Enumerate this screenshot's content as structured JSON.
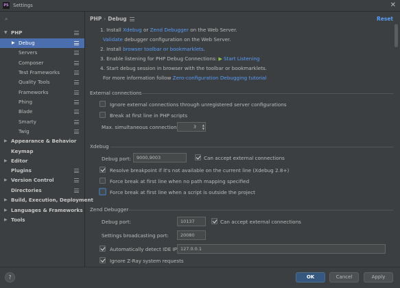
{
  "window": {
    "title": "Settings",
    "app_icon_text": "PS",
    "close_glyph": "✕"
  },
  "search": {
    "value": "",
    "placeholder": ""
  },
  "sidebar": {
    "items": [
      {
        "label": "PHP"
      },
      {
        "label": "Debug"
      },
      {
        "label": "Servers"
      },
      {
        "label": "Composer"
      },
      {
        "label": "Test Frameworks"
      },
      {
        "label": "Quality Tools"
      },
      {
        "label": "Frameworks"
      },
      {
        "label": "Phing"
      },
      {
        "label": "Blade"
      },
      {
        "label": "Smarty"
      },
      {
        "label": "Twig"
      },
      {
        "label": "Appearance & Behavior"
      },
      {
        "label": "Keymap"
      },
      {
        "label": "Editor"
      },
      {
        "label": "Plugins"
      },
      {
        "label": "Version Control"
      },
      {
        "label": "Directories"
      },
      {
        "label": "Build, Execution, Deployment"
      },
      {
        "label": "Languages & Frameworks"
      },
      {
        "label": "Tools"
      }
    ]
  },
  "header": {
    "crumb_parent": "PHP",
    "crumb_sep": "›",
    "crumb_current": "Debug",
    "reset": "Reset"
  },
  "steps": {
    "s1_a": "1. Install ",
    "s1_xdebug": "Xdebug",
    "s1_or": " or ",
    "s1_zend": "Zend Debugger",
    "s1_b": " on the Web Server.",
    "s1_validate": "Validate",
    "s1_validate_rest": " debugger configuration on the Web Server.",
    "s2_a": "2. Install ",
    "s2_link": "browser toolbar or bookmarklets",
    "s2_b": ".",
    "s3_a": "3. Enable listening for PHP Debug Connections: ",
    "s3_link": "Start Listening",
    "s4": "4. Start debug session in browser with the toolbar or bookmarklets.",
    "s4_more": "For more information follow ",
    "s4_link": "Zero-configuration Debugging tutorial"
  },
  "external": {
    "title": "External connections",
    "ignore_unregistered": "Ignore external connections through unregistered server configurations",
    "break_first_line": "Break at first line in PHP scripts",
    "max_label": "Max. simultaneous connections:",
    "max_value": "3"
  },
  "xdebug": {
    "title": "Xdebug",
    "port_label": "Debug port:",
    "port_value": "9000,9003",
    "accept_external": "Can accept external connections",
    "resolve_bp": "Resolve breakpoint if it's not available on the current line (Xdebug 2.8+)",
    "force_break_mapping": "Force break at first line when no path mapping specified",
    "force_break_outside": "Force break at first line when a script is outside the project"
  },
  "zend": {
    "title": "Zend Debugger",
    "port_label": "Debug port:",
    "port_value": "10137",
    "accept_external": "Can accept external connections",
    "broadcast_label": "Settings broadcasting port:",
    "broadcast_value": "20080",
    "auto_detect": "Automatically detect IDE IP:",
    "ide_ip": "127.0.0.1",
    "ignore_zray": "Ignore Z-Ray system requests"
  },
  "footer": {
    "help": "?",
    "ok": "OK",
    "cancel": "Cancel",
    "apply": "Apply"
  },
  "colors": {
    "selection": "#4b6eaf",
    "link": "#589df6",
    "primary_button": "#365880",
    "background": "#3c3f41"
  }
}
